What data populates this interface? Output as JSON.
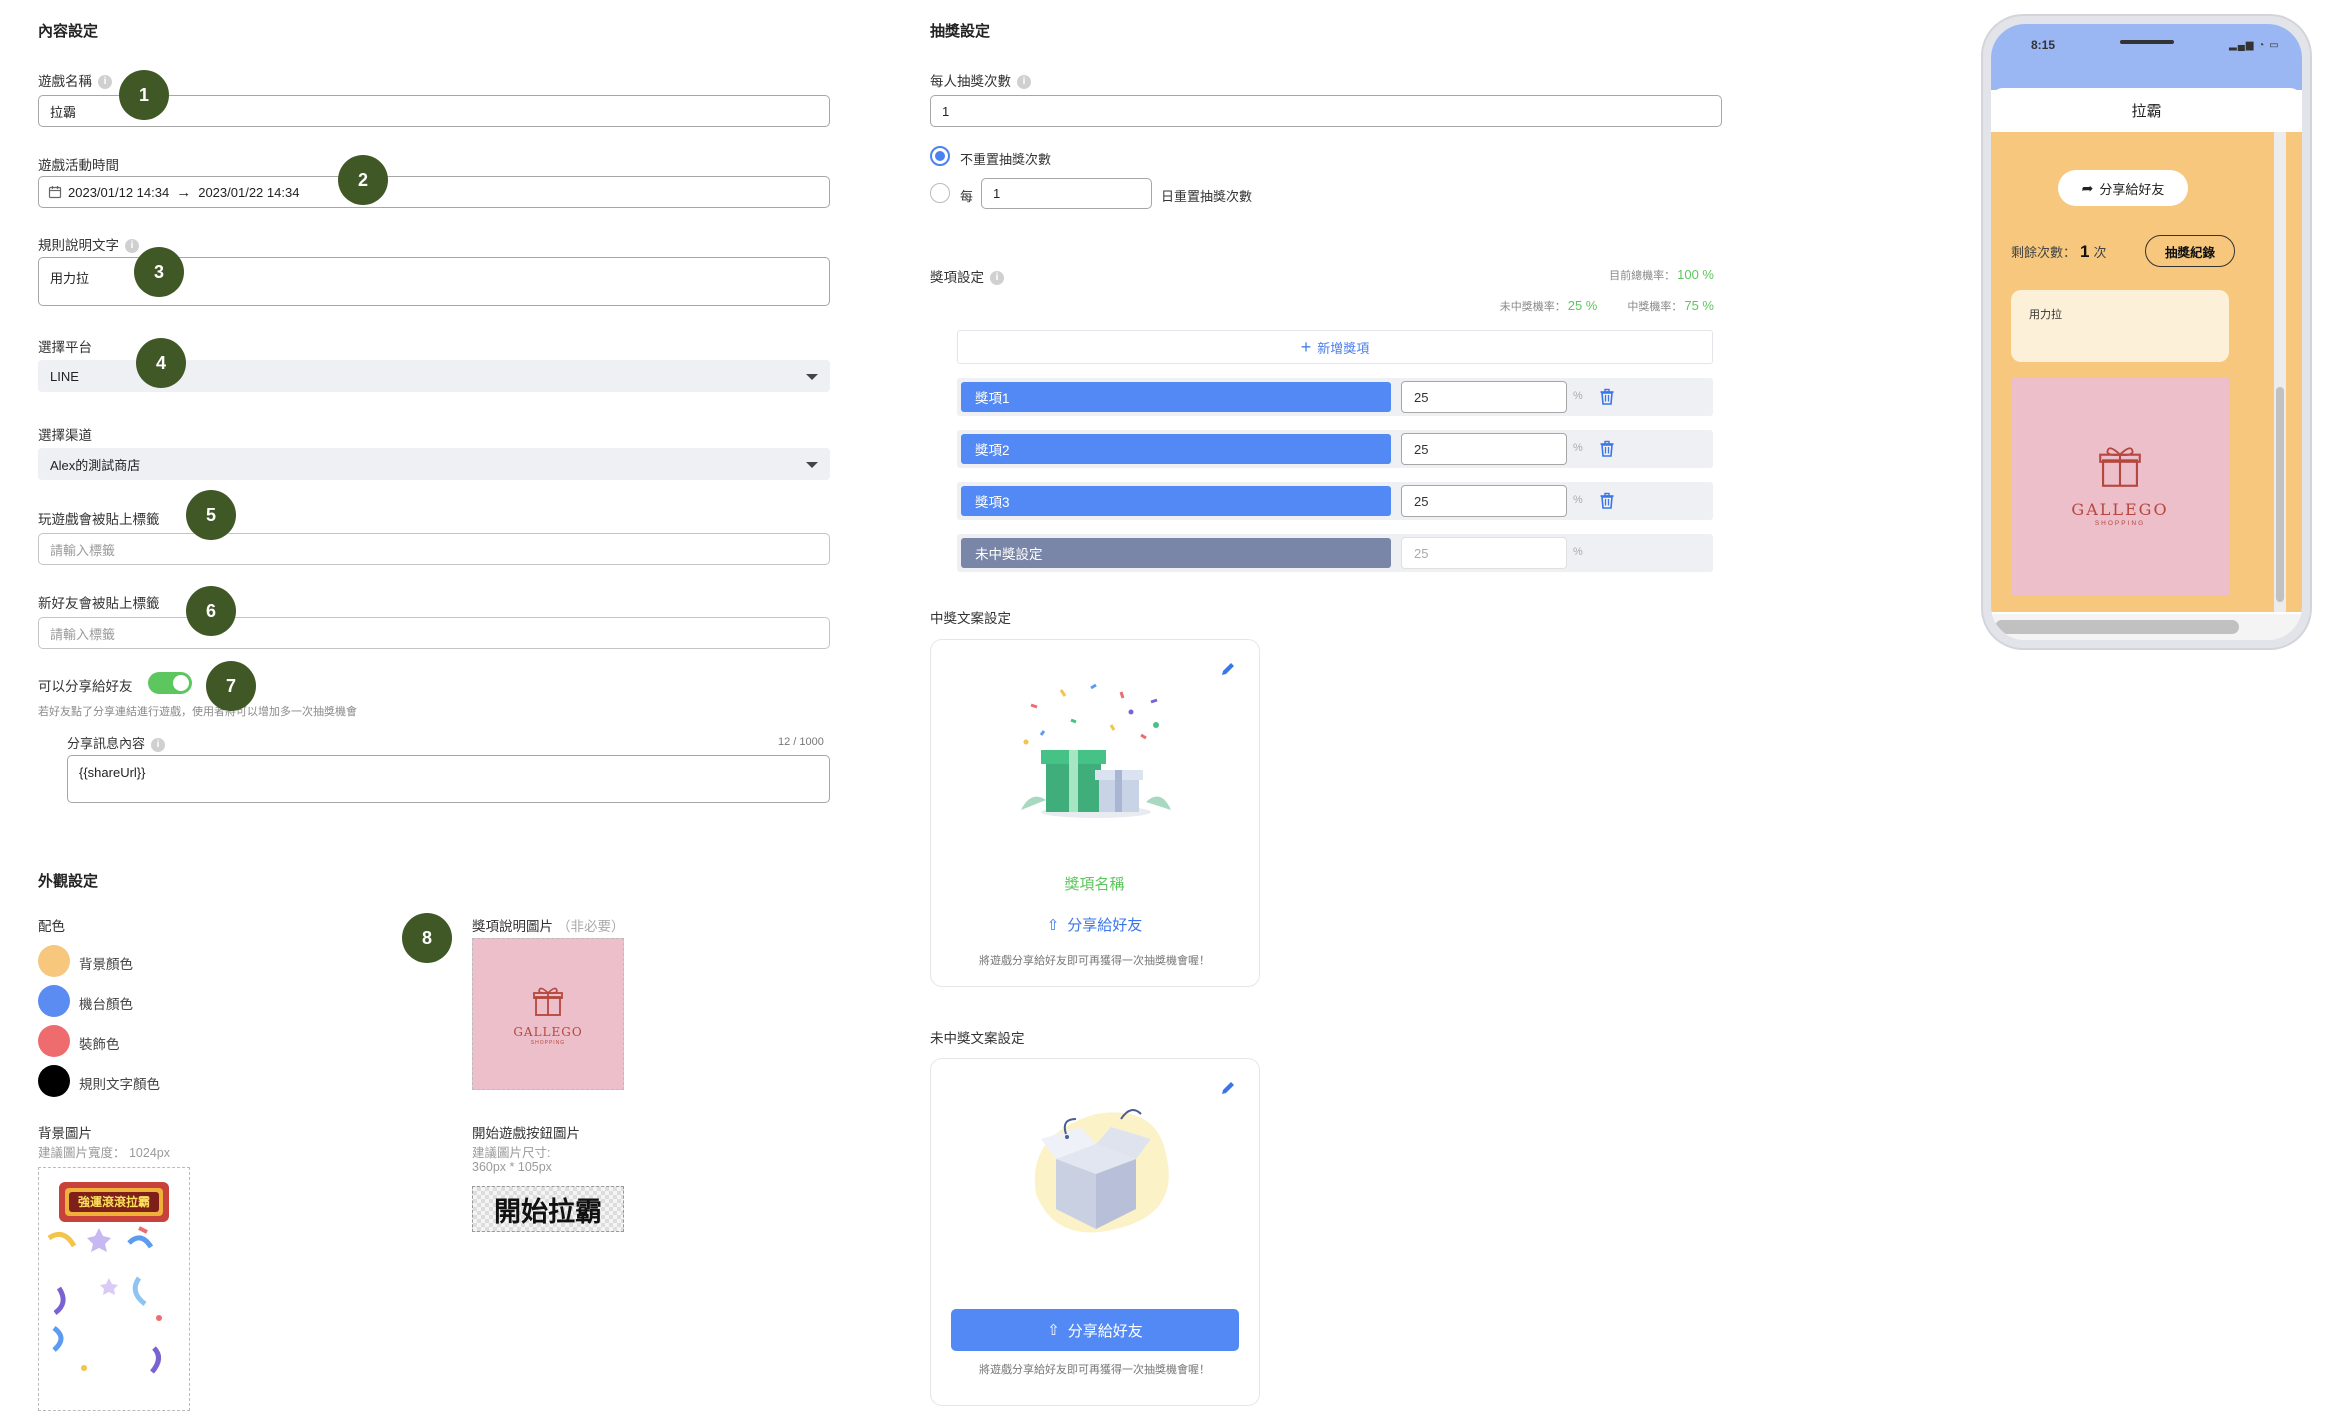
{
  "content_settings": {
    "title": "內容設定",
    "game_name": {
      "label": "遊戲名稱",
      "value": "拉霸"
    },
    "game_time": {
      "label": "遊戲活動時間",
      "start": "2023/01/12 14:34",
      "arrow": "→",
      "end": "2023/01/22 14:34"
    },
    "rules": {
      "label": "規則說明文字",
      "value": "用力拉"
    },
    "platform": {
      "label": "選擇平台",
      "value": "LINE"
    },
    "channel": {
      "label": "選擇渠道",
      "value": "Alex的測試商店"
    },
    "play_tag": {
      "label": "玩遊戲會被貼上標籤",
      "placeholder": "請輸入標籤"
    },
    "friend_tag": {
      "label": "新好友會被貼上標籤",
      "placeholder": "請輸入標籤"
    },
    "share": {
      "label": "可以分享給好友",
      "hint": "若好友點了分享連結進行遊戲，使用者將可以增加多一次抽獎機會",
      "msg_label": "分享訊息內容",
      "msg_count": "12 / 1000",
      "msg_value": "{{shareUrl}}",
      "enabled": true
    }
  },
  "badges": [
    "1",
    "2",
    "3",
    "4",
    "5",
    "6",
    "7",
    "8"
  ],
  "appearance": {
    "title": "外觀設定",
    "colors_label": "配色",
    "colors": [
      {
        "name": "背景顏色",
        "hex": "#f6c77d"
      },
      {
        "name": "機台顏色",
        "hex": "#5a8cf2"
      },
      {
        "name": "裝飾色",
        "hex": "#ee6b6e"
      },
      {
        "name": "規則文字顏色",
        "hex": "#000000"
      }
    ],
    "bg_image": {
      "label": "背景圖片",
      "hint": "建議圖片寬度： 1024px",
      "banner_text": "強運滾滾拉霸"
    },
    "prize_image": {
      "label": "獎項說明圖片",
      "optional": "（非必要）"
    },
    "start_button": {
      "label": "開始遊戲按鈕圖片",
      "hint1": "建議圖片尺寸:",
      "hint2": "360px * 105px",
      "image_text": "開始拉霸"
    },
    "brand": {
      "name": "GALLEGO",
      "sub": "SHOPPING",
      "pink": "#ecbfcb"
    }
  },
  "lottery": {
    "title": "抽獎設定",
    "per_person": {
      "label": "每人抽獎次數",
      "value": "1"
    },
    "no_reset": "不重置抽獎次數",
    "reset_prefix": "每",
    "reset_value": "1",
    "reset_suffix": "日重置抽獎次數",
    "prize_settings_label": "獎項設定",
    "total_rate_label": "目前總機率：",
    "total_rate": "100 %",
    "lose_rate_label": "未中獎機率：",
    "lose_rate": "25 %",
    "win_rate_label": "中獎機率：",
    "win_rate": "75 %",
    "add_prize": "新增獎項",
    "prizes": [
      {
        "name": "獎項1",
        "value": "25",
        "pct": "%"
      },
      {
        "name": "獎項2",
        "value": "25",
        "pct": "%"
      },
      {
        "name": "獎項3",
        "value": "25",
        "pct": "%"
      }
    ],
    "no_prize": {
      "name": "未中獎設定",
      "value": "25",
      "pct": "%"
    },
    "win_copy_label": "中獎文案設定",
    "win_card": {
      "prize_name": "獎項名稱",
      "share": "分享給好友",
      "note": "將遊戲分享給好友即可再獲得一次抽獎機會喔！"
    },
    "lose_copy_label": "未中獎文案設定",
    "lose_card": {
      "share": "分享給好友",
      "note": "將遊戲分享給好友即可再獲得一次抽獎機會喔！"
    }
  },
  "phone": {
    "time": "8:15",
    "title": "拉霸",
    "share_btn": "分享給好友",
    "remaining_label": "剩餘次數：",
    "remaining_count": "1",
    "remaining_unit": "次",
    "history_btn": "抽獎紀錄",
    "rules_text": "用力拉"
  },
  "colors": {
    "primary": "#5289f4",
    "green": "#5ec65e",
    "badge": "#3f5826",
    "grey_bar": "#7a86a8"
  }
}
